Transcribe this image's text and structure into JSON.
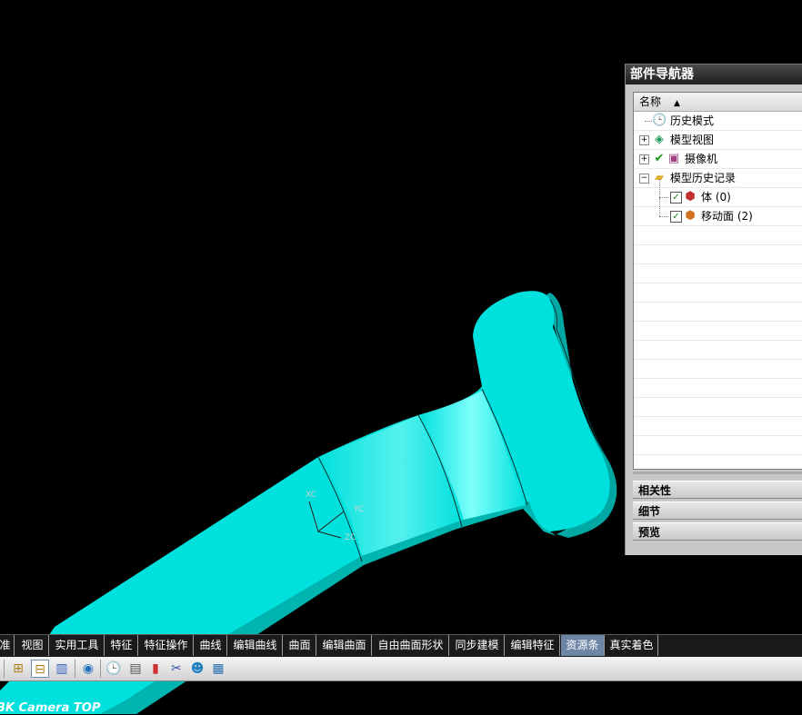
{
  "part_navigator": {
    "title": "部件导航器",
    "column_header": "名称",
    "tree": [
      {
        "label": "历史模式",
        "icon": "clock-icon"
      },
      {
        "label": "模型视图",
        "icon": "model-views-icon",
        "expandable": true
      },
      {
        "label": "摄像机",
        "icon": "camera-icon",
        "expandable": true,
        "checked": true
      },
      {
        "label": "模型历史记录",
        "icon": "folder-icon",
        "expandable": true,
        "expanded": true
      },
      {
        "label": "体 (0)",
        "icon": "body-feature-icon",
        "checked": true
      },
      {
        "label": "移动面 (2)",
        "icon": "move-face-icon",
        "checked": true
      }
    ],
    "sections": [
      "相关性",
      "细节",
      "预览"
    ]
  },
  "tabs": [
    {
      "label": "准"
    },
    {
      "label": "视图"
    },
    {
      "label": "实用工具"
    },
    {
      "label": "特征"
    },
    {
      "label": "特征操作"
    },
    {
      "label": "曲线"
    },
    {
      "label": "编辑曲线"
    },
    {
      "label": "曲面"
    },
    {
      "label": "编辑曲面"
    },
    {
      "label": "自由曲面形状"
    },
    {
      "label": "同步建模"
    },
    {
      "label": "编辑特征"
    },
    {
      "label": "资源条",
      "active": true
    },
    {
      "label": "真实着色"
    }
  ],
  "toolbar_icons": [
    "assembly-navigator-icon",
    "part-navigator-icon",
    "reuse-library-icon",
    "web-browser-icon",
    "history-icon",
    "system-materials-icon",
    "color-palette-icon",
    "process-studio-icon",
    "roles-icon",
    "system-scenes-icon"
  ],
  "viewport": {
    "view_label": "BK Camera TOP",
    "csys_labels": {
      "x": "XC",
      "y": "YC",
      "z": "ZC"
    },
    "colors": {
      "background": "#000000",
      "part": "#00e0dc",
      "part_shadow": "#00a8a4",
      "part_highlight": "#80fffb"
    }
  }
}
